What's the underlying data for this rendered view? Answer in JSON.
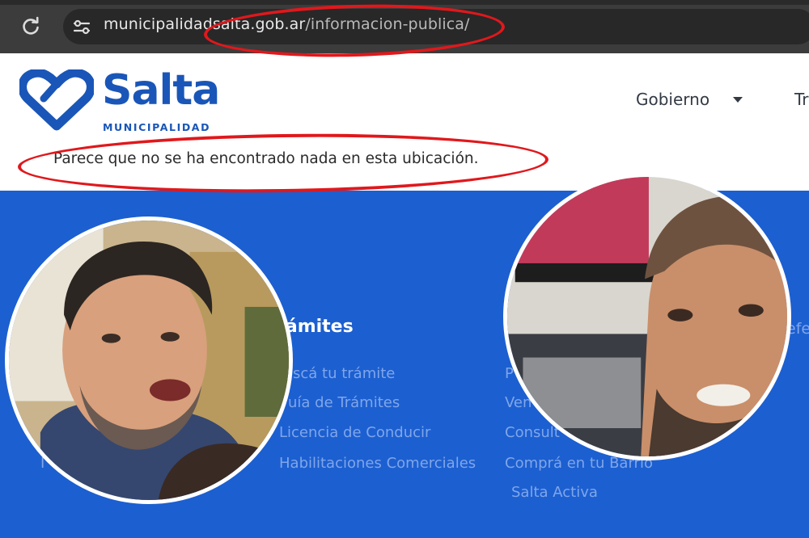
{
  "browser": {
    "url_host": "municipalidadsalta.gob.ar",
    "url_path": "/informacion-publica/",
    "icons": [
      "reload-icon",
      "site-info-icon"
    ]
  },
  "header": {
    "logo_word": "Salta",
    "logo_sub": "MUNICIPALIDAD",
    "nav_gobierno": "Gobierno",
    "nav_next": "Tr",
    "not_found_message": "Parece que no se ha encontrado nada en esta ubicación."
  },
  "footer": {
    "heading": "rámites",
    "links_col1": [
      "scá tu trámite",
      "uía de Trámites",
      "Licencia de Conducir",
      "Habilitaciones Comerciales"
    ],
    "links_col2": [
      "P",
      "Ven",
      "Consult",
      "Comprá en tu Barrio",
      "Salta Activa"
    ],
    "edge_text": "efe",
    "left_fragment": "I"
  },
  "colors": {
    "brand_blue": "#1a56b8",
    "footer_blue": "#1c5fd0",
    "annotation_red": "#e0181c"
  }
}
